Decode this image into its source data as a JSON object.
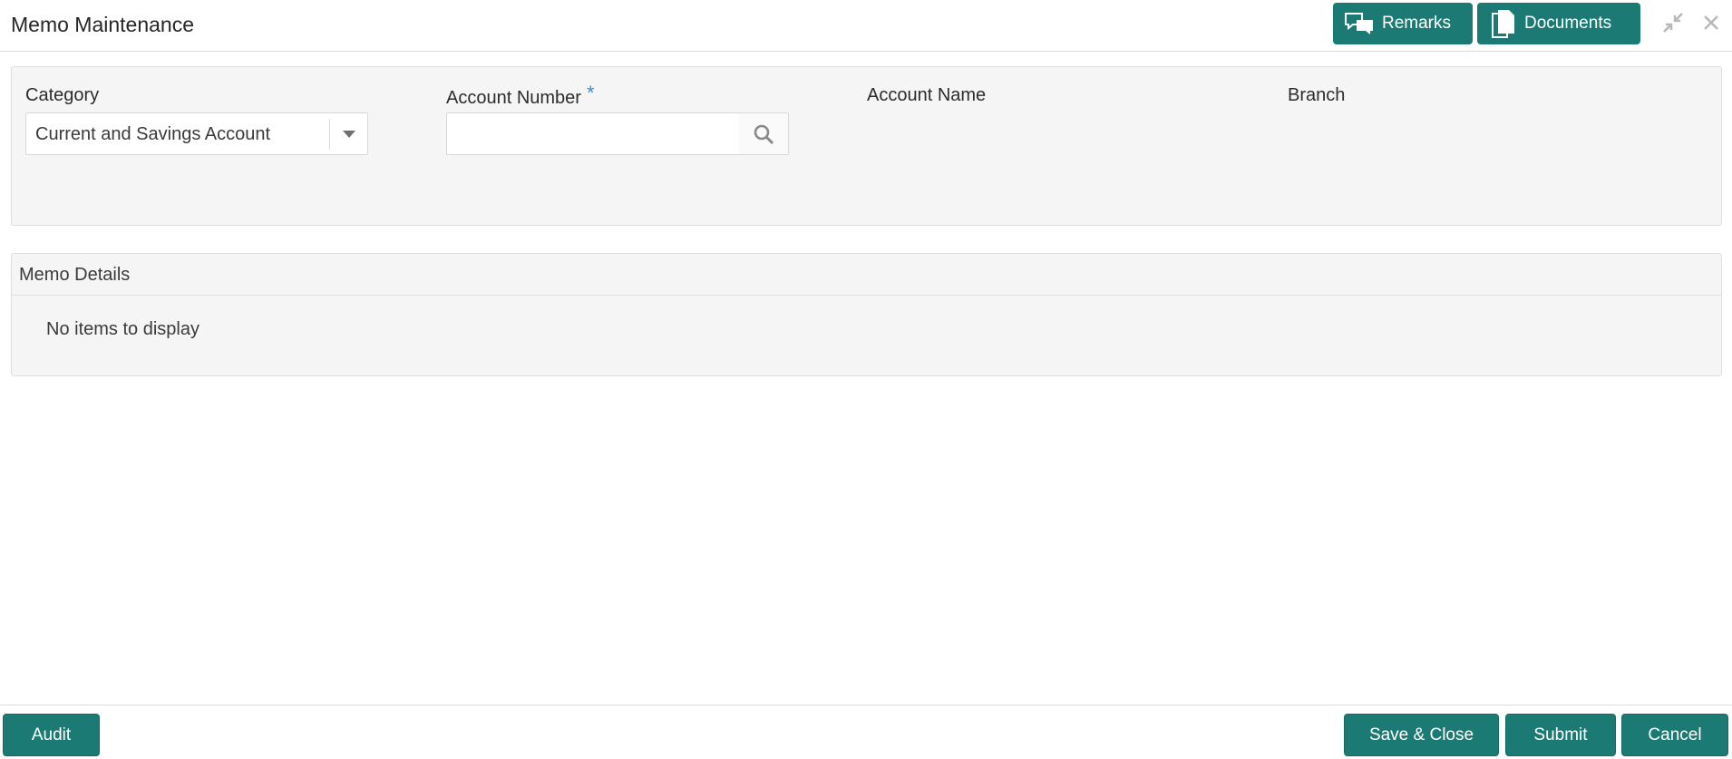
{
  "header": {
    "title": "Memo Maintenance",
    "remarks_label": "Remarks",
    "documents_label": "Documents"
  },
  "form": {
    "category_label": "Category",
    "category_value": "Current and Savings Account",
    "account_number_label": "Account Number",
    "required_mark": "*",
    "account_number_value": "",
    "account_name_label": "Account Name",
    "branch_label": "Branch"
  },
  "memo": {
    "title": "Memo Details",
    "empty_text": "No items to display"
  },
  "footer": {
    "audit_label": "Audit",
    "save_close_label": "Save & Close",
    "submit_label": "Submit",
    "cancel_label": "Cancel"
  },
  "colors": {
    "accent": "#1b7a73",
    "required": "#3d8ec9",
    "panel_bg": "#f5f5f5"
  },
  "icons": [
    "remarks-icon",
    "documents-icon",
    "minimize-icon",
    "close-icon",
    "dropdown-arrow-icon",
    "search-icon"
  ]
}
